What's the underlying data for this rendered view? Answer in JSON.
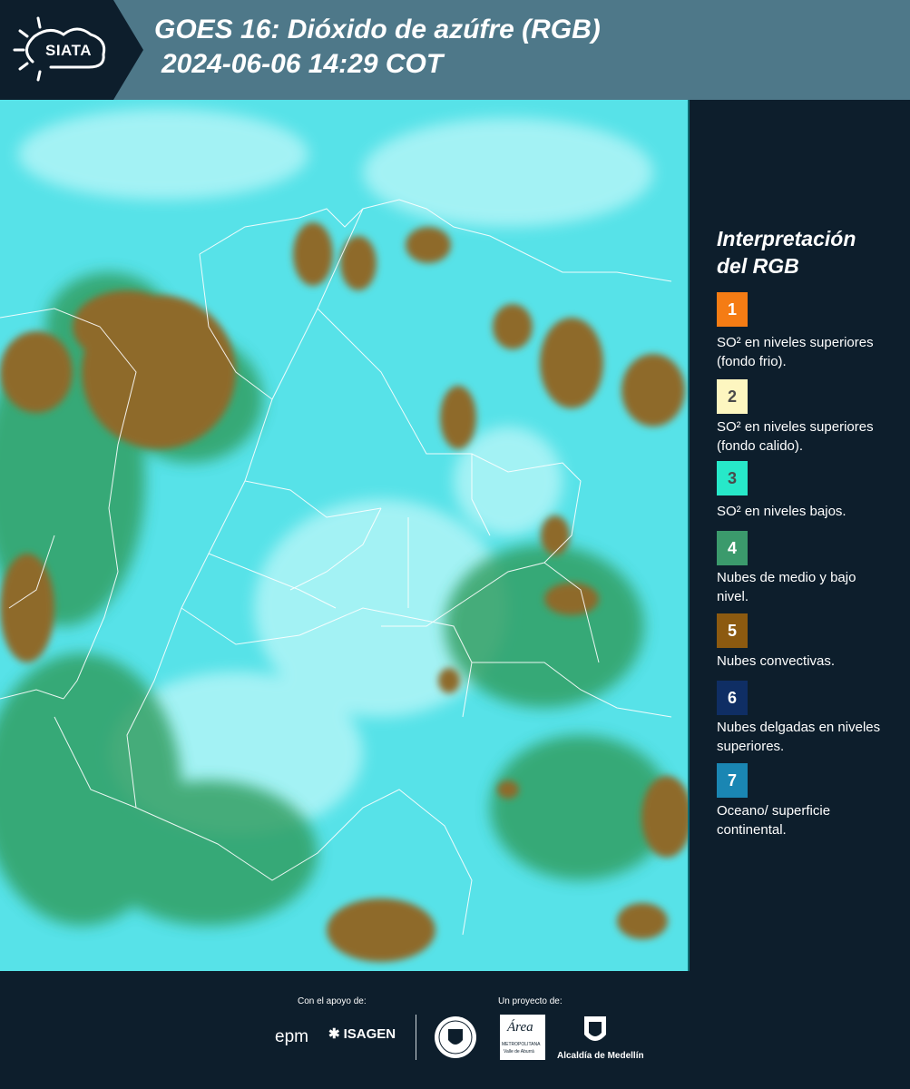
{
  "header": {
    "logo_text": "SIATA",
    "title_line1": "GOES 16: Dióxido de azúfre (RGB)",
    "title_line2": "2024-06-06 14:29 COT"
  },
  "legend": {
    "title_line1": "Interpretación",
    "title_line2": "del RGB",
    "items": [
      {
        "number": "1",
        "color": "#f57c14",
        "text_color": "#ffffff",
        "description": "SO² en niveles superiores (fondo frio)."
      },
      {
        "number": "2",
        "color": "#fdf6c0",
        "text_color": "#4a4a4a",
        "description": "SO² en niveles superiores (fondo calido)."
      },
      {
        "number": "3",
        "color": "#27e8c9",
        "text_color": "#4a4a4a",
        "description": "SO² en niveles bajos."
      },
      {
        "number": "4",
        "color": "#3b9a6c",
        "text_color": "#ffffff",
        "description": "Nubes de medio y bajo nivel."
      },
      {
        "number": "5",
        "color": "#8c5a10",
        "text_color": "#ffffff",
        "description": "Nubes convectivas."
      },
      {
        "number": "6",
        "color": "#0f2e64",
        "text_color": "#ffffff",
        "description": "Nubes delgadas en niveles superiores."
      },
      {
        "number": "7",
        "color": "#1a86b3",
        "text_color": "#ffffff",
        "description": "Oceano/ superficie continental."
      }
    ]
  },
  "footer": {
    "support_label": "Con el apoyo de:",
    "project_label": "Un proyecto de:",
    "sponsor_epm": "epm",
    "sponsor_isagen": "ISAGEN",
    "partner_area": "Área",
    "partner_area_sub": "METROPOLITANA",
    "partner_area_sub2": "Valle de Aburrá",
    "partner_alcaldia": "Alcaldía de Medellín"
  }
}
